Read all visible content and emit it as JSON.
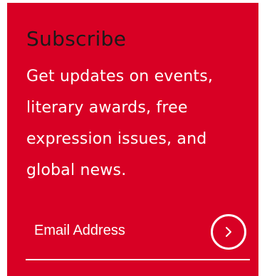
{
  "subscribe": {
    "title": "Subscribe",
    "description": "Get updates on events, literary awards, free expression issues, and global news.",
    "email_placeholder": "Email Address",
    "submit_icon": "chevron-right-icon"
  },
  "colors": {
    "background": "#d80024",
    "title": "#1a1a1a",
    "text": "#ffffff"
  }
}
